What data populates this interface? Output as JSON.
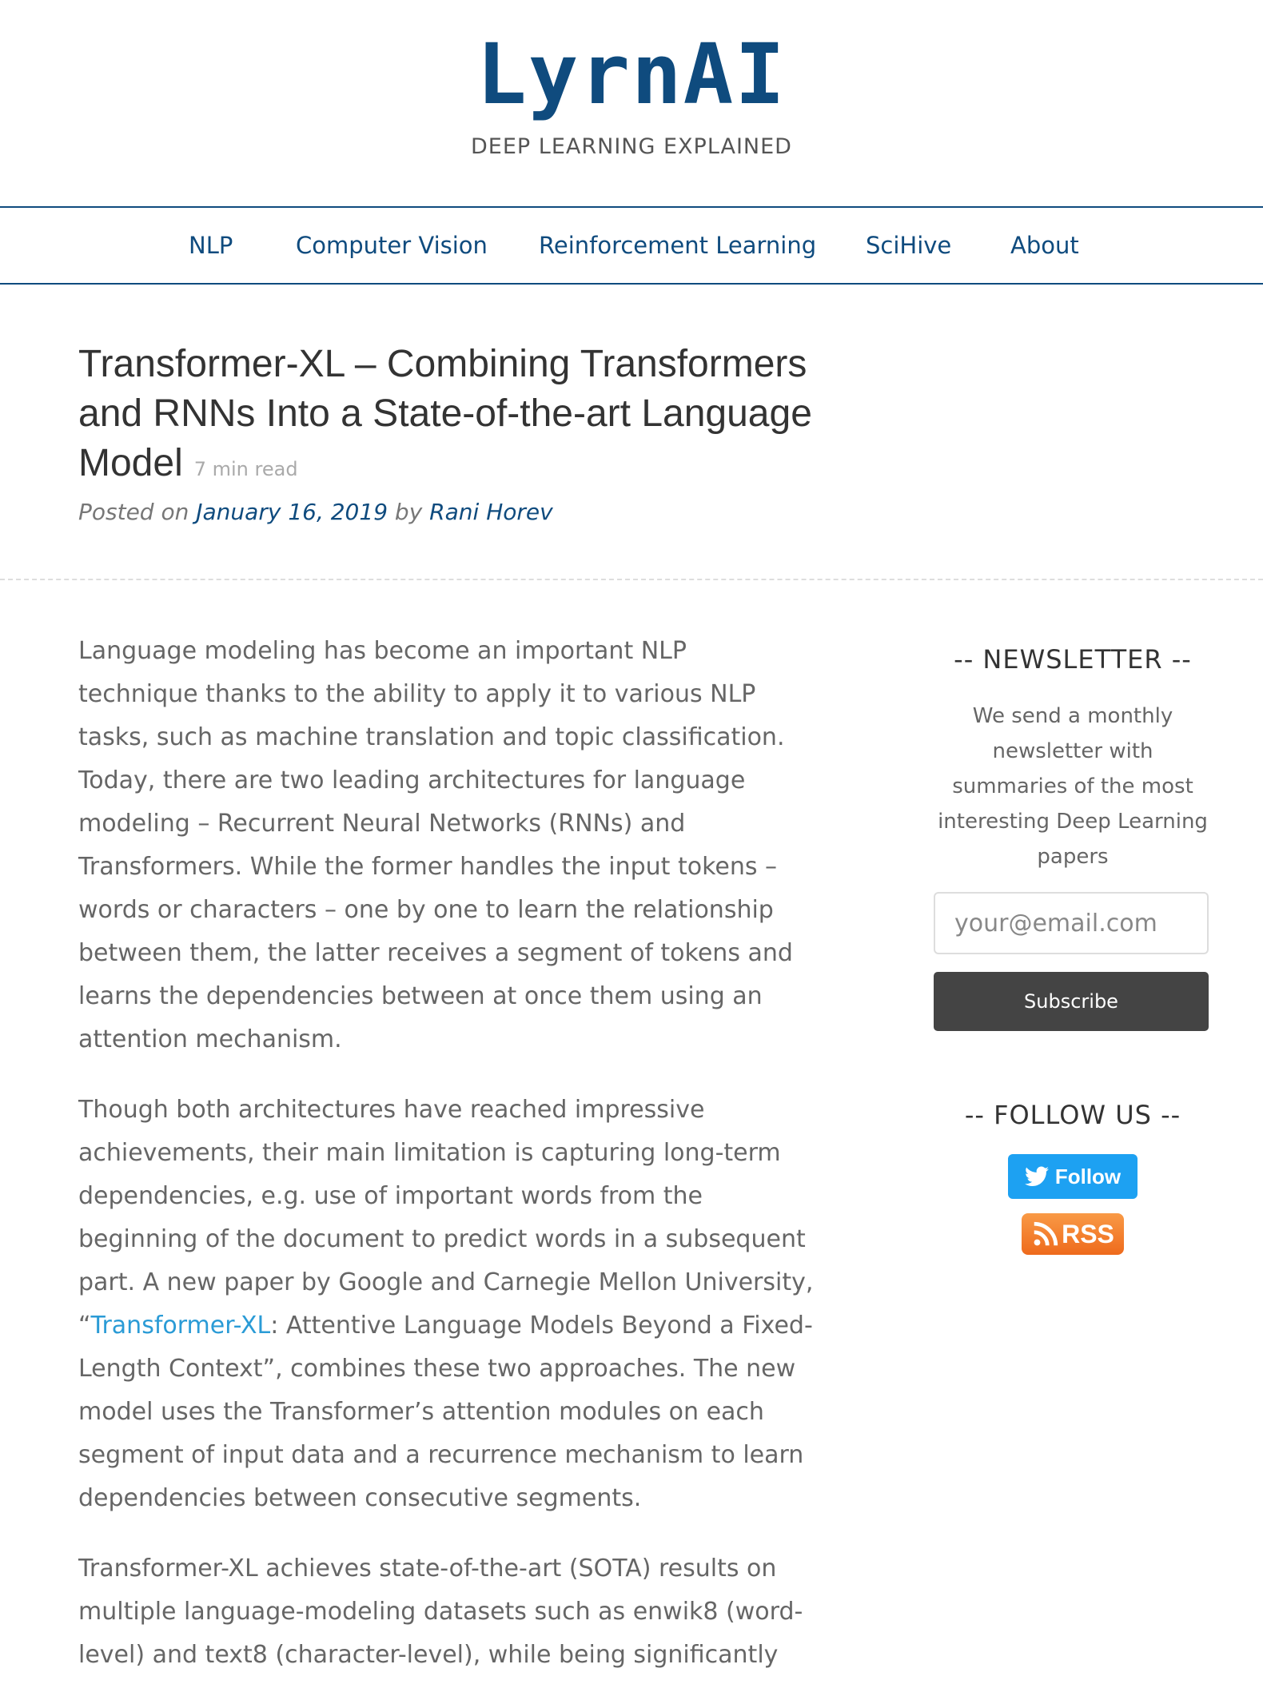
{
  "header": {
    "logo_text": "LyrnAI",
    "tagline": "DEEP LEARNING EXPLAINED"
  },
  "nav": {
    "items": [
      {
        "label": "NLP"
      },
      {
        "label": "Computer Vision"
      },
      {
        "label": "Reinforcement Learning"
      },
      {
        "label": "SciHive"
      },
      {
        "label": "About"
      }
    ]
  },
  "post": {
    "title": "Transformer-XL – Combining Transformers and RNNs Into a State-of-the-art Language Model",
    "read_time": "7 min read",
    "posted_on_label": "Posted on",
    "date": "January 16, 2019",
    "by_label": "by",
    "author": "Rani Horev"
  },
  "article": {
    "p1": "Language modeling has become an important NLP technique thanks to the ability to apply it to various NLP tasks, such as machine translation and topic classification. Today, there are two leading architectures for language modeling – Recurrent Neural Networks (RNNs) and Transformers. While the former handles the input tokens – words or characters – one by one to learn the relationship between them, the latter receives a segment of tokens and learns the dependencies between at once them using an attention mechanism.",
    "p2_before": "Though both architectures have reached impressive achievements, their main limitation is capturing long-term dependencies, e.g. use of important words from the beginning of the document to predict words in a subsequent part. A new paper by Google and Carnegie Mellon University, “",
    "p2_link": "Transformer-XL",
    "p2_after": ": Attentive Language Models Beyond a Fixed-Length Context”, combines these two approaches. The new model uses the Transformer’s attention modules on each segment of input data and a recurrence mechanism to learn dependencies between consecutive segments.",
    "p3": "Transformer-XL achieves state-of-the-art (SOTA) results on multiple language-modeling datasets such as enwik8 (word-level) and text8 (character-level), while being significantly"
  },
  "sidebar": {
    "newsletter_title": "--  NEWSLETTER  --",
    "newsletter_desc": "We send a monthly newsletter with summaries of the most interesting Deep Learning papers",
    "email_placeholder": "your@email.com",
    "subscribe_label": "Subscribe",
    "follow_title": "--  FOLLOW US  --",
    "twitter_label": "Follow",
    "rss_label": "RSS"
  },
  "colors": {
    "brand": "#0f4b7e",
    "link": "#2a9bd6",
    "twitter": "#1da1f2",
    "rss": "#f47b20",
    "button_dark": "#444444"
  },
  "icons": [
    "twitter-bird-icon",
    "rss-feed-icon"
  ]
}
